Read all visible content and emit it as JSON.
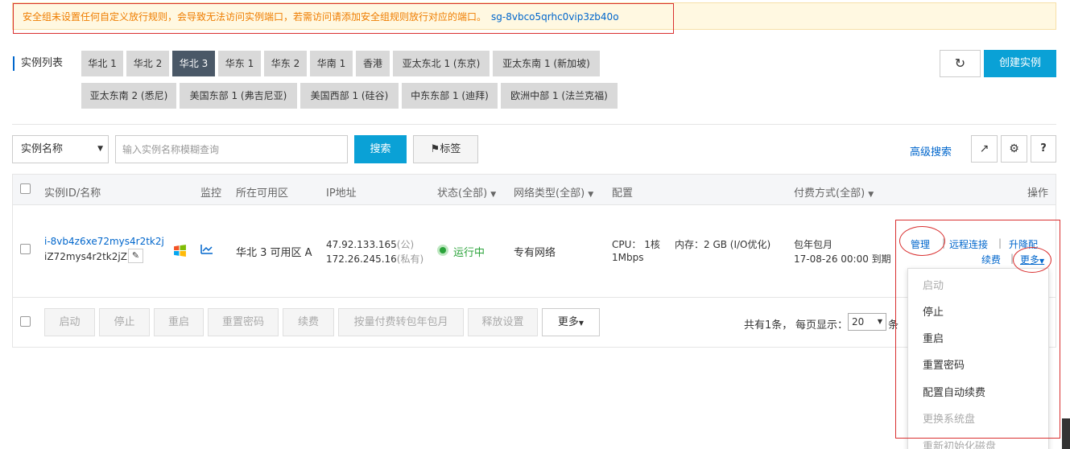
{
  "warning": {
    "message": "安全组未设置任何自定义放行规则，会导致无法访问实例端口，若需访问请添加安全组规则放行对应的端口。",
    "security_group_id": "sg-8vbco5qrhc0vip3zb40o"
  },
  "instance_list_title": "实例列表",
  "regions": [
    "华北 1",
    "华北 2",
    "华北 3",
    "华东 1",
    "华东 2",
    "华南 1",
    "香港",
    "亚太东北 1 (东京)",
    "亚太东南 1 (新加坡)",
    "亚太东南 2 (悉尼)",
    "美国东部 1 (弗吉尼亚)",
    "美国西部 1 (硅谷)",
    "中东东部 1 (迪拜)",
    "欧洲中部 1 (法兰克福)"
  ],
  "active_region": "华北 3",
  "toolbar": {
    "refresh_icon": "refresh-icon",
    "create_instance": "创建实例",
    "search_field_selected": "实例名称",
    "search_placeholder": "输入实例名称模糊查询",
    "search_button": "搜索",
    "tag_button": "标签",
    "advanced_search": "高级搜索",
    "export_icon": "export-icon",
    "settings_icon": "gear-icon",
    "help_label": "?"
  },
  "table": {
    "headers": {
      "instance_id_name": "实例ID/名称",
      "monitor": "监控",
      "zone": "所在可用区",
      "ip": "IP地址",
      "status": "状态(全部)",
      "network": "网络类型(全部)",
      "config": "配置",
      "billing": "付费方式(全部)",
      "actions": "操作"
    },
    "rows": [
      {
        "instance_id": "i-8vb4z6xe72mys4r2tk2j",
        "instance_name": "iZ72mys4r2tk2jZ",
        "zone": "华北 3 可用区 A",
        "public_ip": "47.92.133.165",
        "public_suffix": "(公)",
        "private_ip": "172.26.245.16",
        "private_suffix": "(私有)",
        "status": "运行中",
        "network": "专有网络",
        "config_cpu": "CPU： 1核",
        "config_mem": "内存：2 GB (I/O优化)",
        "config_bw": "1Mbps",
        "billing_type": "包年包月",
        "expire": "17-08-26 00:00 到期",
        "actions": {
          "manage": "管理",
          "remote": "远程连接",
          "upgrade": "升降配",
          "renew": "续费",
          "more": "更多"
        }
      }
    ]
  },
  "batch_actions": [
    "启动",
    "停止",
    "重启",
    "重置密码",
    "续费",
    "按量付费转包年包月",
    "释放设置"
  ],
  "batch_more": "更多",
  "pagination": {
    "total_text": "共有1条，",
    "page_size_label": "每页显示：",
    "page_size": "20",
    "trailing": "条"
  },
  "more_menu": {
    "items": [
      {
        "label": "启动",
        "enabled": false
      },
      {
        "label": "停止",
        "enabled": true
      },
      {
        "label": "重启",
        "enabled": true
      },
      {
        "label": "重置密码",
        "enabled": true
      },
      {
        "label": "配置自动续费",
        "enabled": true
      },
      {
        "label": "更换系统盘",
        "enabled": false
      },
      {
        "label": "重新初始化磁盘",
        "enabled": false
      }
    ]
  },
  "colors": {
    "accent": "#0aa1d6",
    "link": "#0066cc",
    "warning": "#ef7d00",
    "annotation_red": "#d93030",
    "running_green": "#2aa33a"
  }
}
